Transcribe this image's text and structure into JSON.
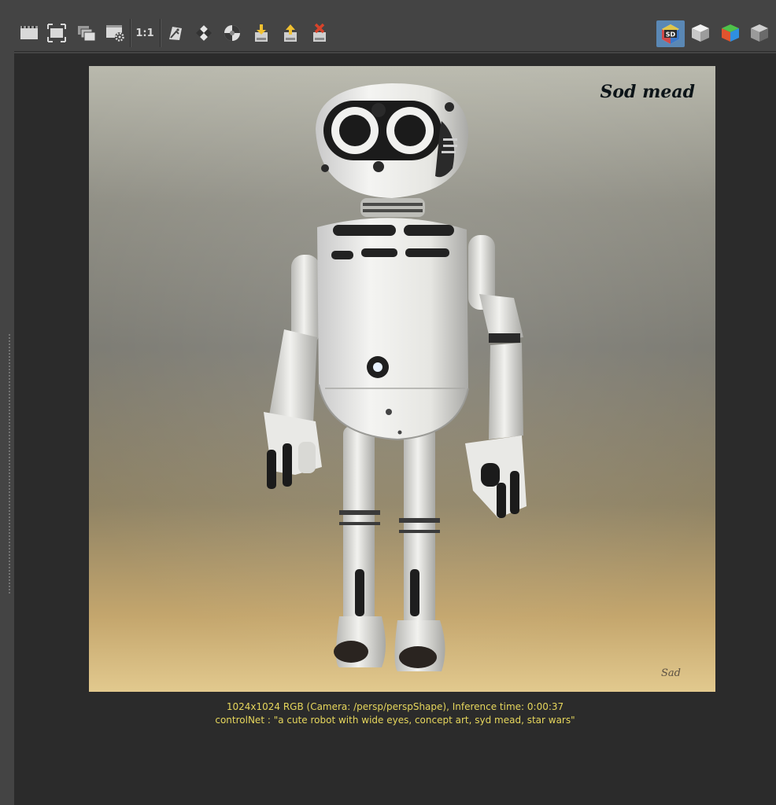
{
  "toolbar": {
    "buttons": [
      {
        "name": "snapshot-icon"
      },
      {
        "name": "frame-all-icon"
      },
      {
        "name": "multiple-renders-icon"
      },
      {
        "name": "render-settings-icon"
      },
      {
        "name": "one-to-one",
        "label": "1:1"
      },
      {
        "name": "color-picker-icon"
      },
      {
        "name": "checker-background-icon"
      },
      {
        "name": "exposure-ball-icon"
      },
      {
        "name": "load-image-icon"
      },
      {
        "name": "save-image-icon"
      },
      {
        "name": "delete-image-icon"
      }
    ],
    "renderers": [
      {
        "name": "stable-diffusion-renderer-icon",
        "label": "SD",
        "active": true
      },
      {
        "name": "white-cube-renderer-icon"
      },
      {
        "name": "color-cube-renderer-icon"
      },
      {
        "name": "gray-cube-renderer-icon"
      }
    ]
  },
  "image": {
    "signature": "Sad",
    "watermark": "Sod mead"
  },
  "info": {
    "line1": "1024x1024 RGB (Camera: /persp/perspShape), Inference time: 0:00:37",
    "line2": "controlNet : \"a cute robot with wide eyes, concept art, syd mead, star wars\""
  },
  "colors": {
    "info_text": "#e6d65c",
    "active_renderer": "#5a88b5",
    "viewport_bg": "#2b2b2b",
    "panel_bg": "#444444"
  }
}
